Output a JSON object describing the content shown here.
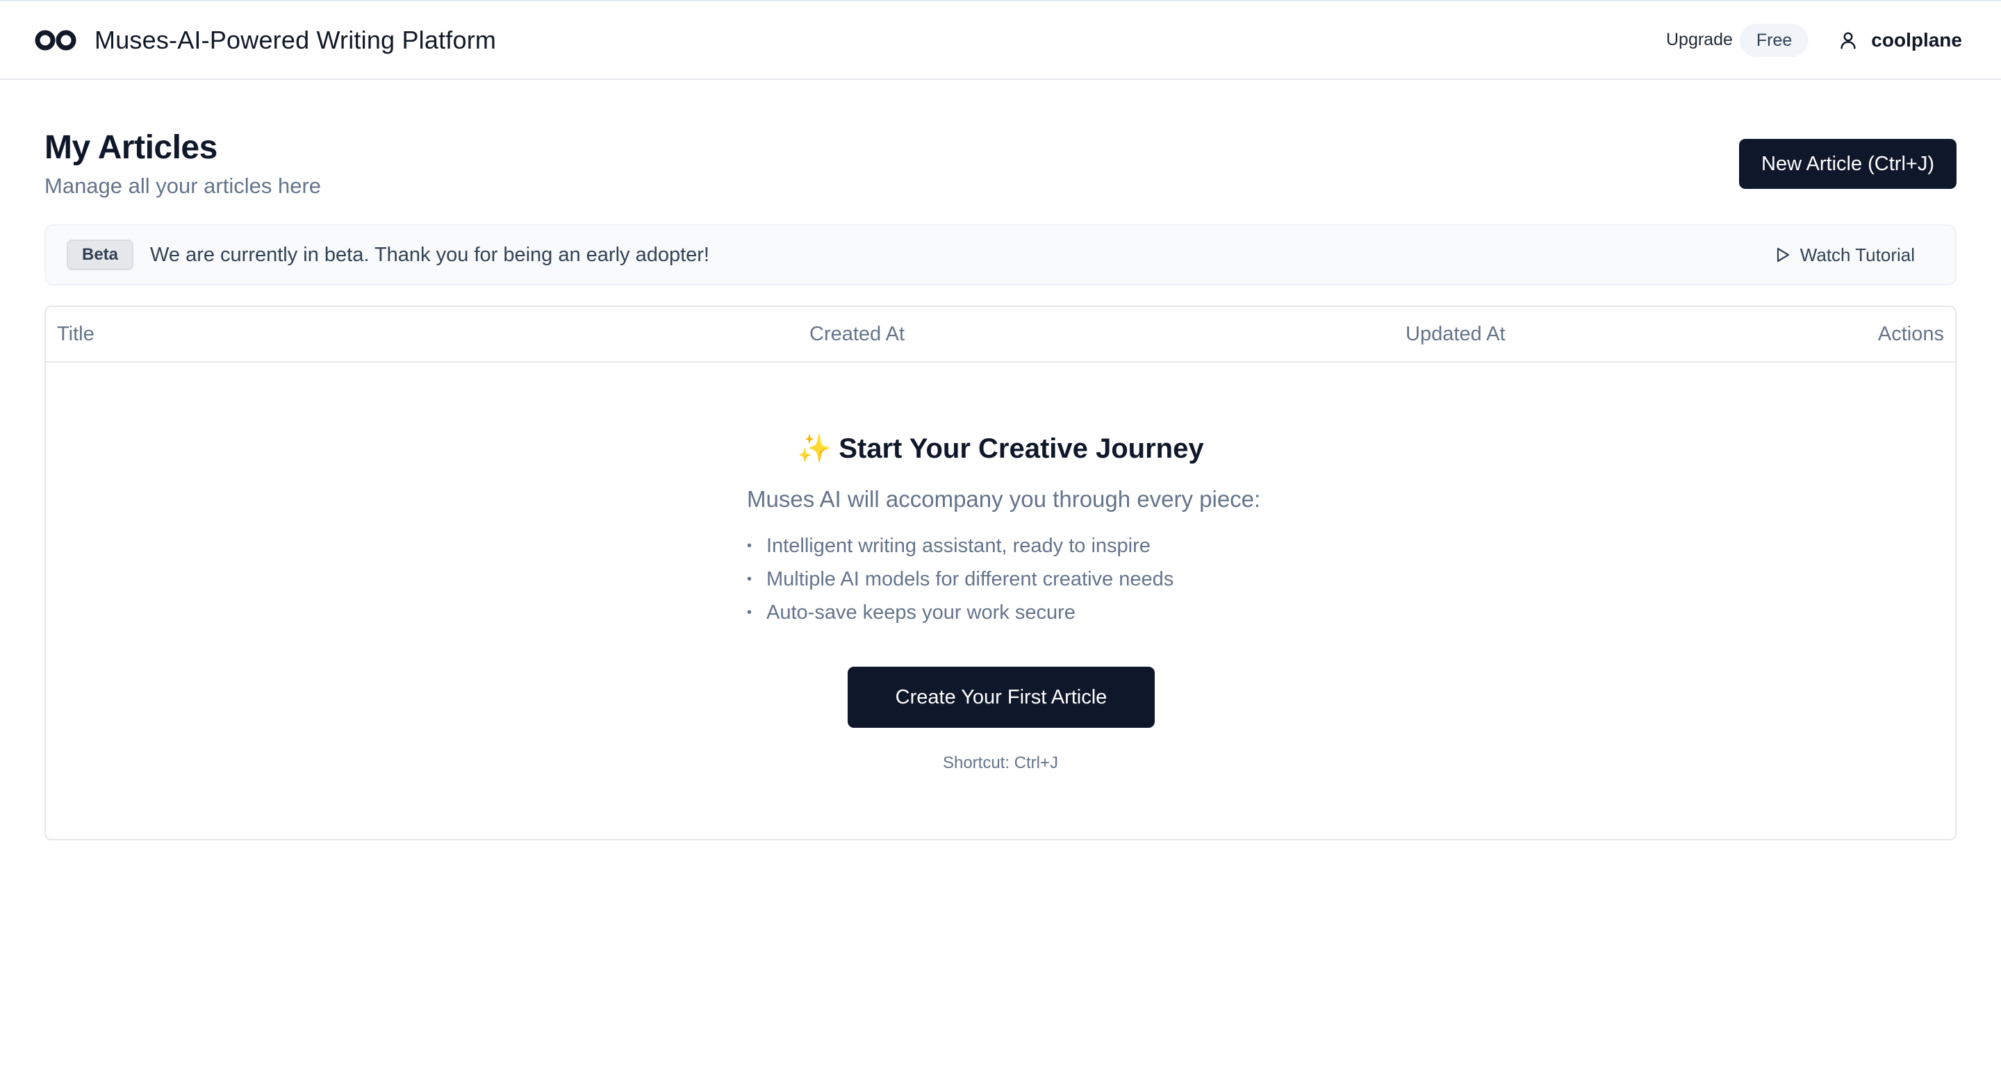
{
  "header": {
    "app_title": "Muses-AI-Powered Writing Platform",
    "logo_icon": "infinity-logo-icon",
    "upgrade_label": "Upgrade",
    "plan_badge": "Free",
    "user_icon": "user-icon",
    "username": "coolplane"
  },
  "page": {
    "title": "My Articles",
    "subtitle": "Manage all your articles here",
    "new_article_label": "New Article (Ctrl+J)"
  },
  "banner": {
    "badge": "Beta",
    "message": "We are currently in beta. Thank you for being an early adopter!",
    "tutorial_icon": "play-icon",
    "tutorial_label": "Watch Tutorial"
  },
  "table": {
    "columns": [
      "Title",
      "Created At",
      "Updated At",
      "Actions"
    ],
    "rows": []
  },
  "empty_state": {
    "emoji": "✨",
    "title": "Start Your Creative Journey",
    "lead": "Muses AI will accompany you through every piece:",
    "features": [
      "Intelligent writing assistant, ready to inspire",
      "Multiple AI models for different creative needs",
      "Auto-save keeps your work secure"
    ],
    "bullet": "•",
    "cta_label": "Create Your First Article",
    "shortcut": "Shortcut: Ctrl+J"
  },
  "colors": {
    "primary": "#0f172a",
    "muted_text": "#64748b",
    "border": "#e5e7eb",
    "banner_bg": "#f8fafc",
    "sparkle": "#f5b92b"
  }
}
